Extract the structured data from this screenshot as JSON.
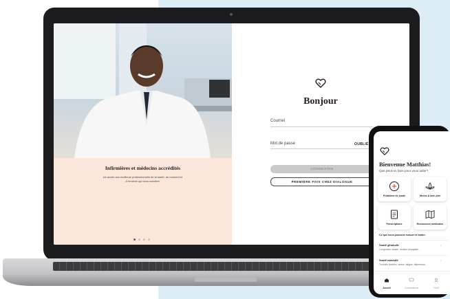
{
  "laptop": {
    "photo_panel": {
      "title": "Infirmières et médecins accrédités",
      "text_line1": "Un accès aux meilleurs professionnels de la santé, au moment et",
      "text_line2": "à l'endroit qui vous convient.",
      "carousel_count": 4,
      "carousel_active": 1
    },
    "login": {
      "greeting": "Bonjour",
      "email_label": "Courriel",
      "password_label": "Mot de passe",
      "forgot_label": "OUBLIÉ?",
      "connect_button": "CONNEXION",
      "first_time_button": "PREMIÈRE FOIS CHEZ DIALOGUE"
    }
  },
  "phone": {
    "welcome": "Bienvenue Matthias!",
    "subtitle": "Que peut-on faire pour vous aider?",
    "tiles": [
      {
        "label": "Problème de santé",
        "icon": "health-problem-icon"
      },
      {
        "label": "Stress & bien-être",
        "icon": "lotus-icon"
      },
      {
        "label": "Prescriptions",
        "icon": "prescription-icon"
      },
      {
        "label": "Ressources médicales",
        "icon": "map-icon"
      }
    ],
    "section_title": "Ce que nous pouvons évaluer et traiter:",
    "list": [
      {
        "title": "Santé générale",
        "desc": "Congestion nasale, douleur amygdale..."
      },
      {
        "title": "Santé mentale",
        "desc": "Troubles anxieux, stress, fatigue, dépression..."
      }
    ],
    "tabs": [
      {
        "label": "Accueil",
        "icon": "home-icon"
      },
      {
        "label": "Conversations",
        "icon": "chat-icon"
      },
      {
        "label": "Profil",
        "icon": "profile-icon"
      }
    ]
  },
  "colors": {
    "accent_dark": "#2a1c1e",
    "photo_panel_bg": "#fbe6da",
    "button_disabled": "#c9c9c9",
    "page_bg_panel": "#dcedf5"
  }
}
